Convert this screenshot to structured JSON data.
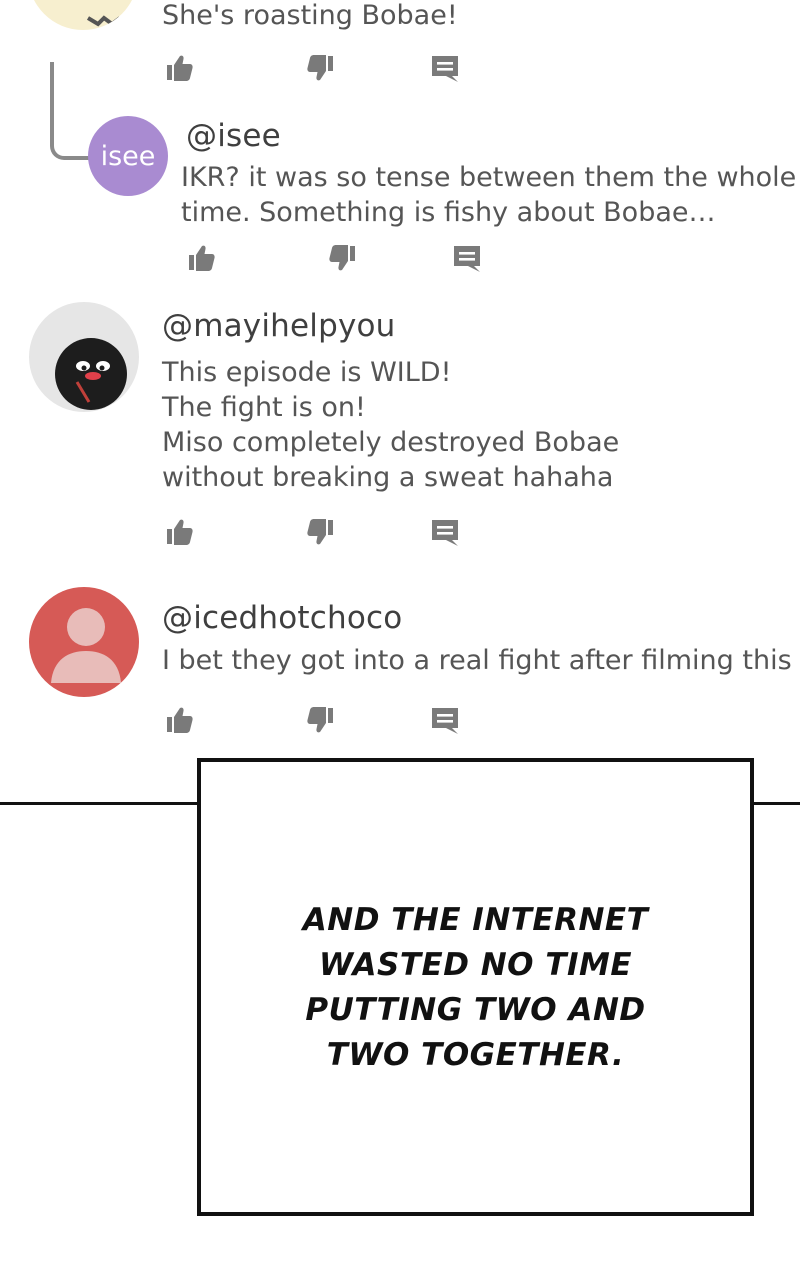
{
  "comments": [
    {
      "text_lines": [
        "She's roasting Bobae!"
      ]
    },
    {
      "username": "@isee",
      "avatar_label": "isee",
      "avatar_color": "#a98bd1",
      "text_lines": [
        "IKR? it was so tense between them the whole",
        "time. Something is fishy about Bobae…"
      ]
    },
    {
      "username": "@mayihelpyou",
      "avatar_color": "#e6e6e6",
      "text_lines": [
        "This episode is WILD!",
        "The fight is on!",
        "Miso completely destroyed Bobae",
        "without breaking a sweat hahaha"
      ]
    },
    {
      "username": "@icedhotchoco",
      "avatar_color": "#d65a56",
      "text_lines": [
        "I bet they got into a real fight after filming this lo"
      ]
    }
  ],
  "icons": {
    "like": "thumbs-up-icon",
    "dislike": "thumbs-down-icon",
    "reply": "comment-icon",
    "icon_color": "#7a7a7a"
  },
  "caption": {
    "lines": [
      "AND THE INTERNET",
      "WASTED NO TIME",
      "PUTTING TWO AND",
      "TWO TOGETHER."
    ]
  }
}
